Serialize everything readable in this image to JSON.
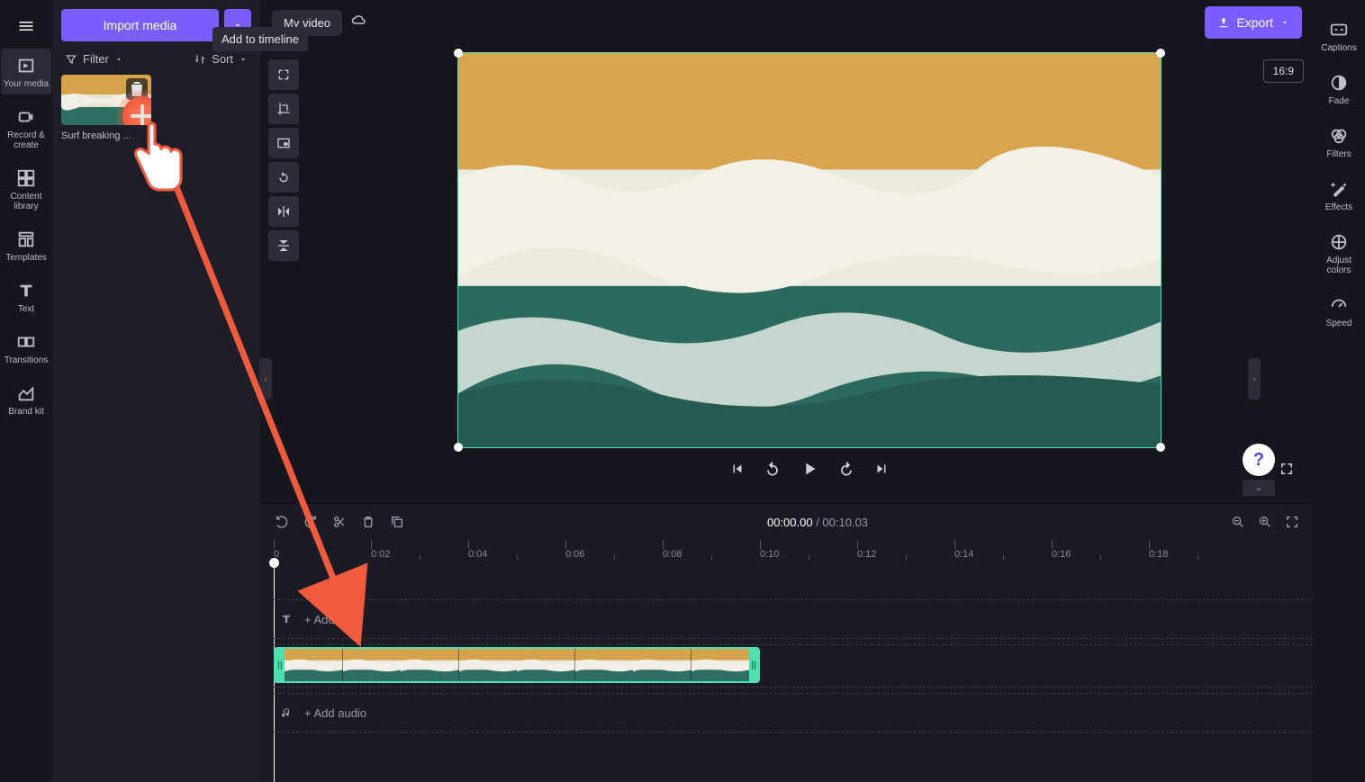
{
  "left_nav": {
    "items": [
      {
        "label": "Your media"
      },
      {
        "label": "Record & create"
      },
      {
        "label": "Content library"
      },
      {
        "label": "Templates"
      },
      {
        "label": "Text"
      },
      {
        "label": "Transitions"
      },
      {
        "label": "Brand kit"
      }
    ]
  },
  "media_panel": {
    "import_label": "Import media",
    "filter_label": "Filter",
    "sort_label": "Sort",
    "clip_title": "Surf breaking ...",
    "tooltip": "Add to timeline"
  },
  "topbar": {
    "project_name": "My video",
    "export_label": "Export",
    "aspect": "16:9"
  },
  "playback": {
    "current_time": "00:00.00",
    "separator": " / ",
    "total_time": "00:10.03"
  },
  "ruler": [
    "0",
    "0:02",
    "0:04",
    "0:06",
    "0:08",
    "0:10",
    "0:12",
    "0:14",
    "0:16",
    "0:18"
  ],
  "timeline": {
    "text_hint": "+  Add text",
    "audio_hint": "+  Add audio"
  },
  "right_nav": {
    "items": [
      {
        "label": "Captions"
      },
      {
        "label": "Fade"
      },
      {
        "label": "Filters"
      },
      {
        "label": "Effects"
      },
      {
        "label": "Adjust colors"
      },
      {
        "label": "Speed"
      }
    ]
  },
  "help": "?"
}
